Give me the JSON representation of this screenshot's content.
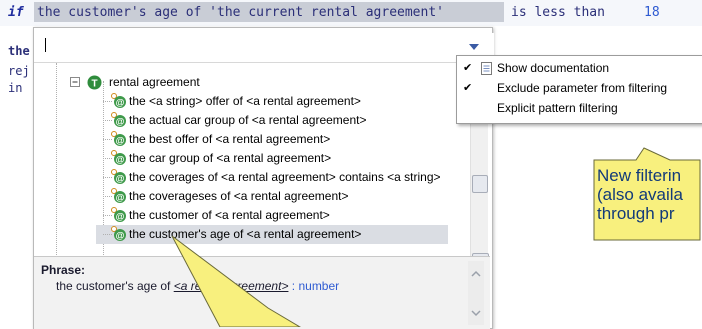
{
  "editor": {
    "keyword_if": "if",
    "highlighted_phrase": "the customer's age of 'the current rental agreement'",
    "rest_of_condition": "is less than",
    "number": "18",
    "side_then": "the",
    "side_reject": "rej",
    "side_in": "in"
  },
  "popup": {
    "search_value": "",
    "tree": {
      "root_label": "rental agreement",
      "items": [
        "the <a string> offer of <a rental agreement>",
        "the actual car group of <a rental agreement>",
        "the best offer of <a rental agreement>",
        "the car group of <a rental agreement>",
        "the coverages of <a rental agreement> contains <a string>",
        "the coverageses of <a rental agreement>",
        "the customer of <a rental agreement>",
        "the customer's age of <a rental agreement>"
      ],
      "selected_index": 7
    },
    "phrase": {
      "title": "Phrase:",
      "prefix": "the customer's age of",
      "term": "<a rental agreement>",
      "type": ": number"
    }
  },
  "filter_menu": {
    "items": [
      {
        "label": "Show documentation",
        "checked": true
      },
      {
        "label": "Exclude parameter from filtering",
        "checked": true
      },
      {
        "label": "Explicit pattern filtering",
        "checked": false
      }
    ]
  },
  "callout": {
    "line1": "New filterin",
    "line2": "(also availa",
    "line3": "through pr"
  },
  "colors": {
    "callout_fill": "#f8f07e",
    "callout_text": "#123a7a",
    "number": "#2f5bd2"
  }
}
